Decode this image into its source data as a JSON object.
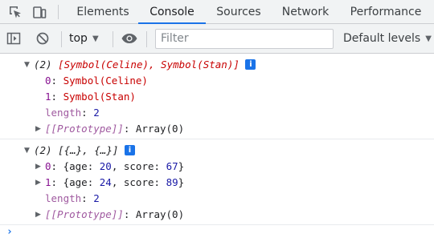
{
  "tabs": [
    {
      "label": "Elements",
      "active": false
    },
    {
      "label": "Console",
      "active": true
    },
    {
      "label": "Sources",
      "active": false
    },
    {
      "label": "Network",
      "active": false
    },
    {
      "label": "Performance",
      "active": false
    }
  ],
  "toolbar": {
    "context": "top",
    "filter_placeholder": "Filter",
    "levels": "Default levels"
  },
  "console": {
    "entry1": {
      "count": "(2)",
      "preview": "[Symbol(Celine), Symbol(Stan)]",
      "items": [
        {
          "key": "0",
          "value": "Symbol(Celine)"
        },
        {
          "key": "1",
          "value": "Symbol(Stan)"
        }
      ],
      "length_key": "length",
      "length_value": "2",
      "proto_key": "[[Prototype]]",
      "proto_value": "Array(0)"
    },
    "entry2": {
      "count": "(2)",
      "preview": "[{…}, {…}]",
      "items": [
        {
          "key": "0",
          "age_key": "age",
          "age": "20",
          "score_key": "score",
          "score": "67"
        },
        {
          "key": "1",
          "age_key": "age",
          "age": "24",
          "score_key": "score",
          "score": "89"
        }
      ],
      "length_key": "length",
      "length_value": "2",
      "proto_key": "[[Prototype]]",
      "proto_value": "Array(0)"
    },
    "info_badge": "i",
    "prompt": "›"
  },
  "colors": {
    "accent": "#1a73e8",
    "symbol_red": "#c80000",
    "key_purple": "#881391",
    "number_blue": "#1a1aa6"
  },
  "icons": [
    "inspect-element-icon",
    "device-toolbar-icon",
    "sidebar-toggle-icon",
    "clear-console-icon",
    "eye-icon"
  ]
}
